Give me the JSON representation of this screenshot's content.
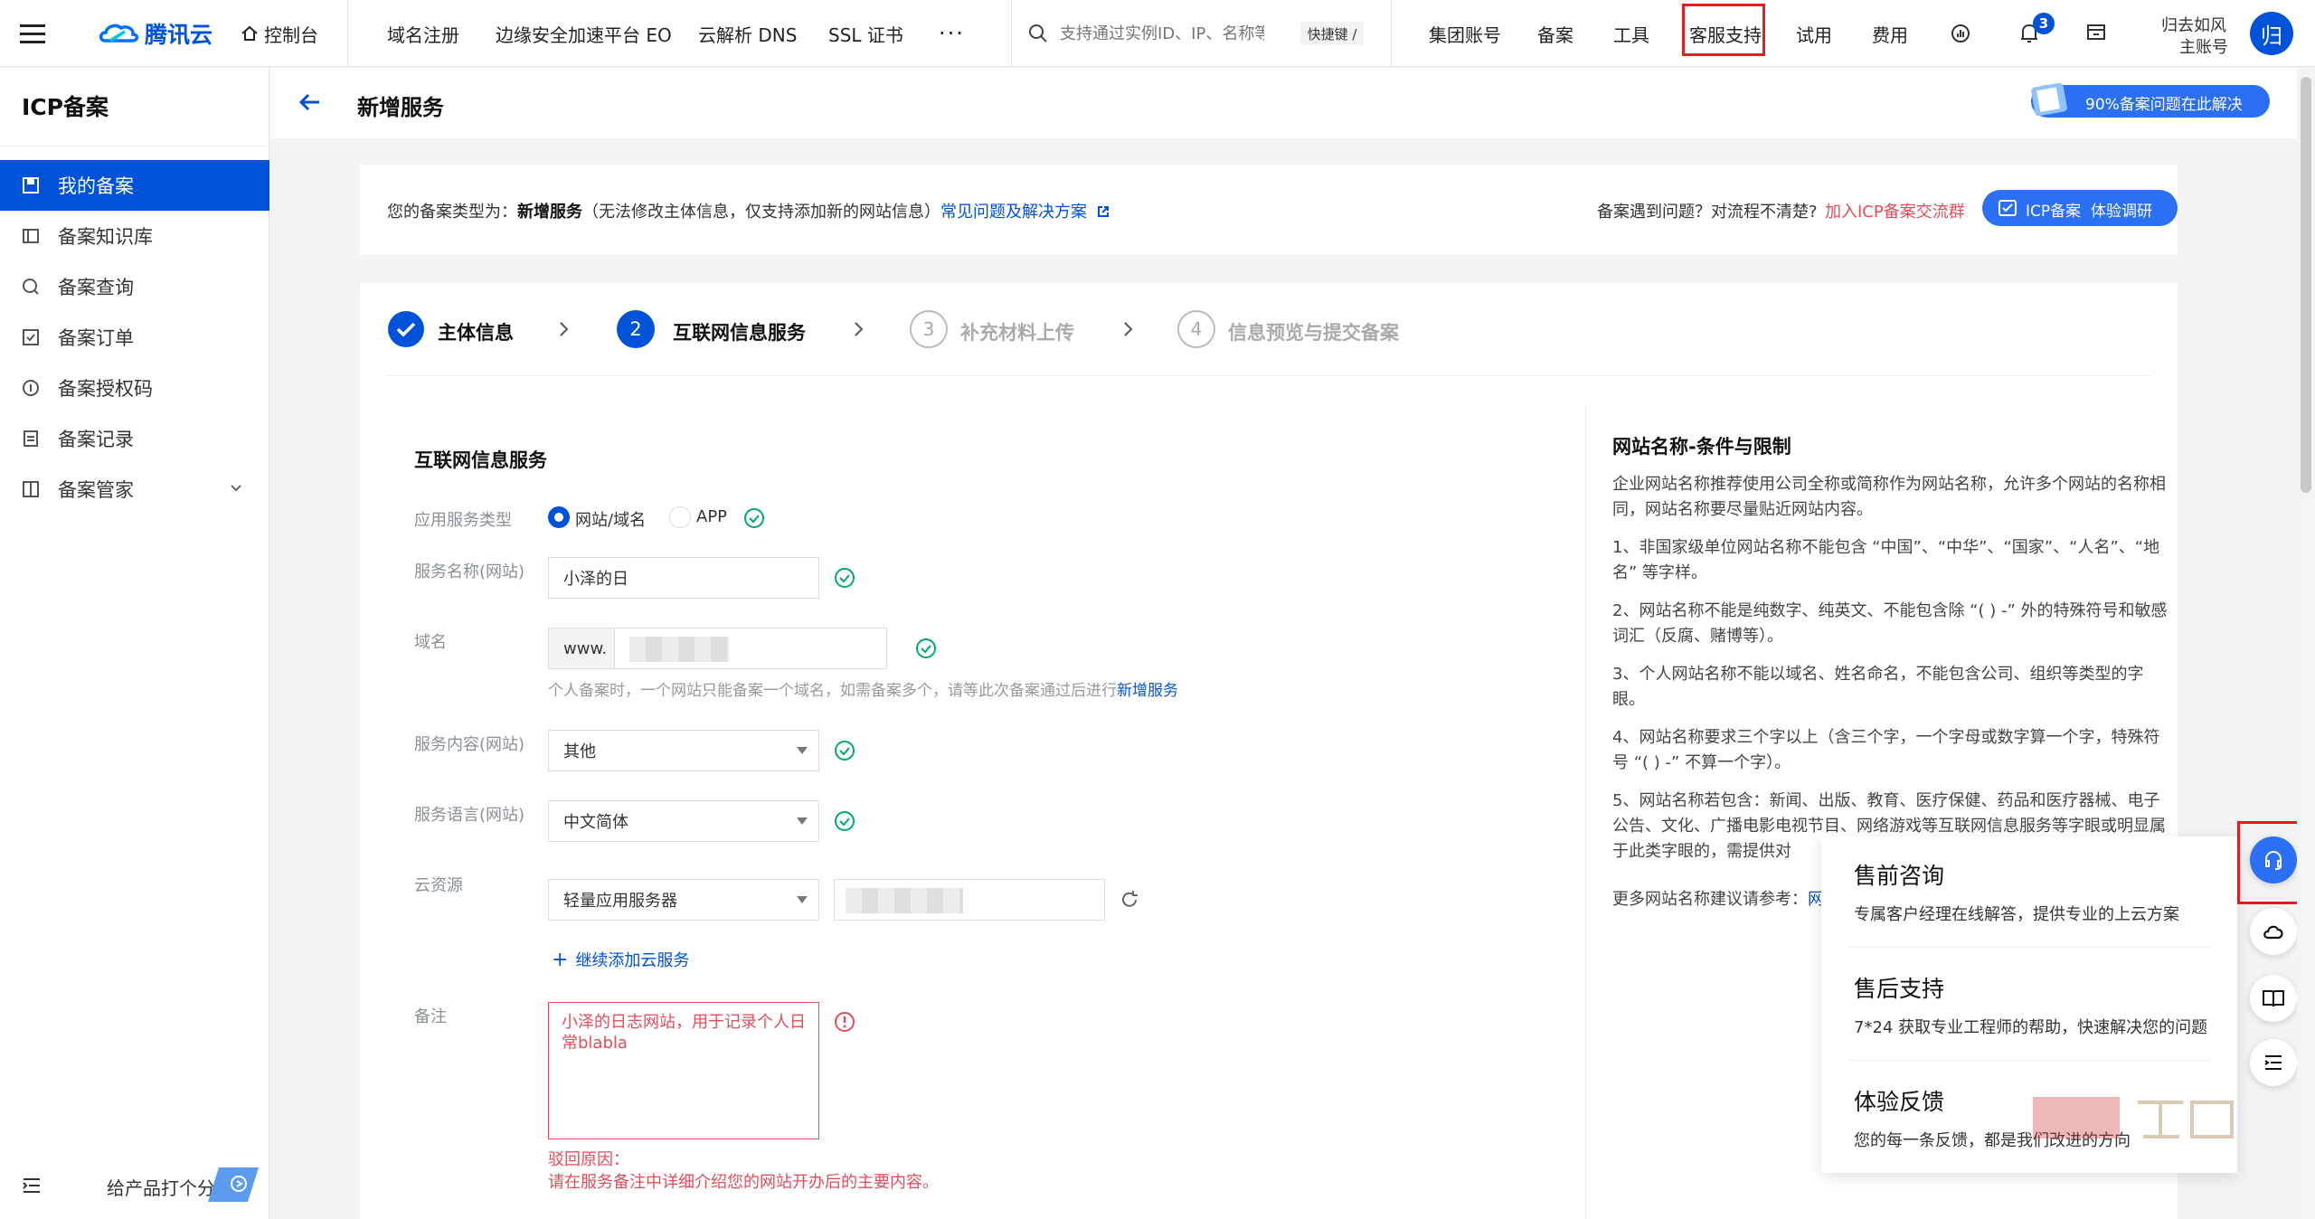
{
  "topbar": {
    "brand": "腾讯云",
    "console": "控制台",
    "nav": [
      "域名注册",
      "边缘安全加速平台 EO",
      "云解析 DNS",
      "SSL 证书"
    ],
    "more": "···",
    "search_placeholder": "支持通过实例ID、IP、名称等",
    "shortcut": "快捷键 /",
    "right": [
      "集团账号",
      "备案",
      "工具",
      "客服支持",
      "试用",
      "费用"
    ],
    "bell_count": "3",
    "user_name": "归去如风",
    "user_role": "主账号",
    "avatar_text": "归"
  },
  "sidebar": {
    "title": "ICP备案",
    "items": [
      "我的备案",
      "备案知识库",
      "备案查询",
      "备案订单",
      "备案授权码",
      "备案记录",
      "备案管家"
    ],
    "bottom": "给产品打个分"
  },
  "header": {
    "title": "新增服务",
    "promo": "90%备案问题在此解决"
  },
  "notice": {
    "prefix": "您的备案类型为：",
    "type": "新增服务",
    "desc": "（无法修改主体信息，仅支持添加新的网站信息）",
    "link": "常见问题及解决方案",
    "right_q": "备案遇到问题？对流程不清楚?",
    "right_link": "加入ICP备案交流群",
    "btn": "ICP备案  体验调研"
  },
  "steps": [
    {
      "num": "",
      "label": "主体信息"
    },
    {
      "num": "2",
      "label": "互联网信息服务"
    },
    {
      "num": "3",
      "label": "补充材料上传"
    },
    {
      "num": "4",
      "label": "信息预览与提交备案"
    }
  ],
  "form": {
    "section": "互联网信息服务",
    "labels": {
      "type": "应用服务类型",
      "name": "服务名称(网站)",
      "domain": "域名",
      "content": "服务内容(网站)",
      "lang": "服务语言(网站)",
      "cloud": "云资源",
      "remark": "备注"
    },
    "radio_site": "网站/域名",
    "radio_app": "APP",
    "name_value": "小泽的日",
    "domain_prefix": "www.",
    "domain_hint": "个人备案时，一个网站只能备案一个域名，如需备案多个，请等此次备案通过后进行",
    "domain_hint_link": "新增服务",
    "content_value": "其他",
    "lang_value": "中文简体",
    "cloud_value": "轻量应用服务器",
    "add_cloud": "继续添加云服务",
    "remark_value": "小泽的日志网站，用于记录个人日常blabla",
    "reject_title": "驳回原因：",
    "reject_desc": "请在服务备注中详细介绍您的网站开办后的主要内容。"
  },
  "rules": {
    "title": "网站名称-条件与限制",
    "intro": "企业网站名称推荐使用公司全称或简称作为网站名称，允许多个网站的名称相同，网站名称要尽量贴近网站内容。",
    "items": [
      "1、非国家级单位网站名称不能包含 “中国”、“中华”、“国家”、“人名”、“地名” 等字样。",
      "2、网站名称不能是纯数字、纯英文、不能包含除 “( ) -” 外的特殊符号和敏感词汇（反腐、赌博等）。",
      "3、个人网站名称不能以域名、姓名命名，不能包含公司、组织等类型的字眼。",
      "4、网站名称要求三个字以上（含三个字，一个字母或数字算一个字，特殊符号 “( ) -” 不算一个字）。",
      "5、网站名称若包含：新闻、出版、教育、医疗保健、药品和医疗器械、电子公告、文化、广播电影电视节目、网络游戏等互联网信息服务等字眼或明显属于此类字眼的，需提供对"
    ],
    "more": "更多网站名称建议请参考：",
    "more_link": "网"
  },
  "popup": [
    {
      "title": "售前咨询",
      "desc": "专属客户经理在线解答，提供专业的上云方案"
    },
    {
      "title": "售后支持",
      "desc": "7*24 获取专业工程师的帮助，快速解决您的问题"
    },
    {
      "title": "体验反馈",
      "desc": "您的每一条反馈，都是我们改进的方向"
    }
  ],
  "colors": {
    "brand": "#0052d9",
    "success": "#00a870",
    "error": "#e34d59",
    "highlight": "#e02020"
  }
}
